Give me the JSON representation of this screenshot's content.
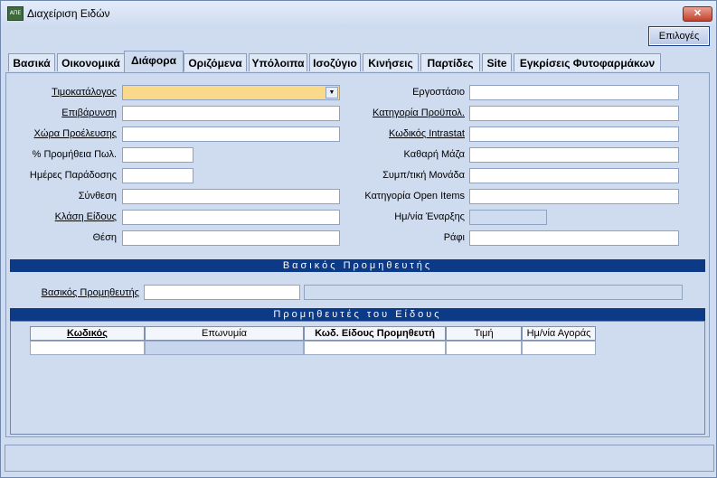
{
  "window": {
    "title": "Διαχείριση Ειδών",
    "icon_text": "ΑΠΕ",
    "close_label": "✕"
  },
  "toolbar": {
    "options_label": "Επιλογές"
  },
  "tabs": [
    {
      "label": "Βασικά"
    },
    {
      "label": "Οικονομικά"
    },
    {
      "label": "Διάφορα",
      "active": true
    },
    {
      "label": "Οριζόμενα"
    },
    {
      "label": "Υπόλοιπα"
    },
    {
      "label": "Ισοζύγιο"
    },
    {
      "label": "Κινήσεις"
    },
    {
      "label": "Παρτίδες"
    },
    {
      "label": "Site"
    },
    {
      "label": "Εγκρίσεις Φυτοφαρμάκων"
    }
  ],
  "left_fields": {
    "price_list": {
      "label": "Τιμοκατάλογος",
      "value": ""
    },
    "surcharge": {
      "label": "Επιβάρυνση",
      "value": ""
    },
    "origin_country": {
      "label": "Χώρα Προέλευσης",
      "value": ""
    },
    "sales_commission": {
      "label": "% Προμήθεια Πωλ.",
      "value": ""
    },
    "delivery_days": {
      "label": "Ημέρες Παράδοσης",
      "value": ""
    },
    "composition": {
      "label": "Σύνθεση",
      "value": ""
    },
    "item_class": {
      "label": "Κλάση Είδους",
      "value": ""
    },
    "position": {
      "label": "Θέση",
      "value": ""
    }
  },
  "right_fields": {
    "factory": {
      "label": "Εργοστάσιο",
      "value": ""
    },
    "budget_category": {
      "label": "Κατηγορία Προϋπολ.",
      "value": ""
    },
    "intrastat_code": {
      "label": "Κωδικός Intrastat",
      "value": ""
    },
    "net_mass": {
      "label": "Καθαρή Μάζα",
      "value": ""
    },
    "supplementary_unit": {
      "label": "Συμπ/τική Μονάδα",
      "value": ""
    },
    "open_items_category": {
      "label": "Κατηγορία Open Items",
      "value": ""
    },
    "start_date": {
      "label": "Ημ/νία Έναρξης",
      "value": ""
    },
    "shelf": {
      "label": "Ράφι",
      "value": ""
    }
  },
  "main_supplier_section": {
    "title": "Βασικός Προμηθευτής",
    "field_label": "Βασικός Προμηθευτής",
    "code": "",
    "name": ""
  },
  "item_suppliers_section": {
    "title": "Προμηθευτές του Είδους",
    "columns": [
      "Κωδικός",
      "Επωνυμία",
      "Κωδ. Είδους Προμηθευτή",
      "Τιμή",
      "Ημ/νία Αγοράς"
    ],
    "rows": [
      [
        "",
        "",
        "",
        "",
        ""
      ]
    ]
  }
}
